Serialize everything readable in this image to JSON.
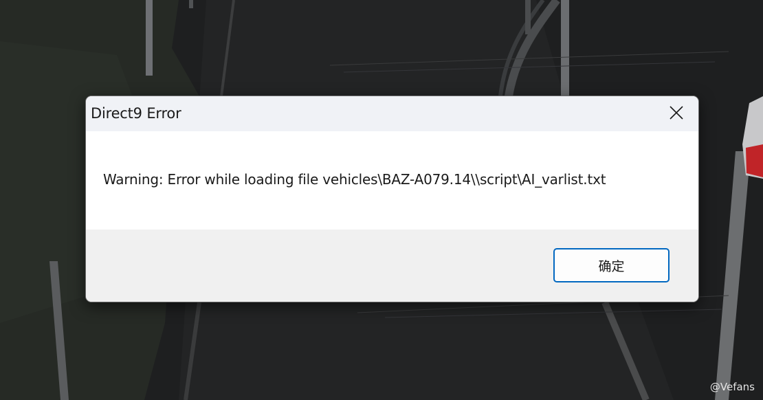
{
  "dialog": {
    "title": "Direct9 Error",
    "message": "Warning: Error while loading file vehicles\\BAZ-A079.14\\\\script\\AI_varlist.txt",
    "ok_label": "确定",
    "close_icon": "close-icon"
  },
  "watermark": "@Vefans",
  "colors": {
    "accent": "#0067c0",
    "titlebar": "#f0f2f6",
    "footer": "#f0f0f0",
    "background": "#1c1d1e"
  }
}
